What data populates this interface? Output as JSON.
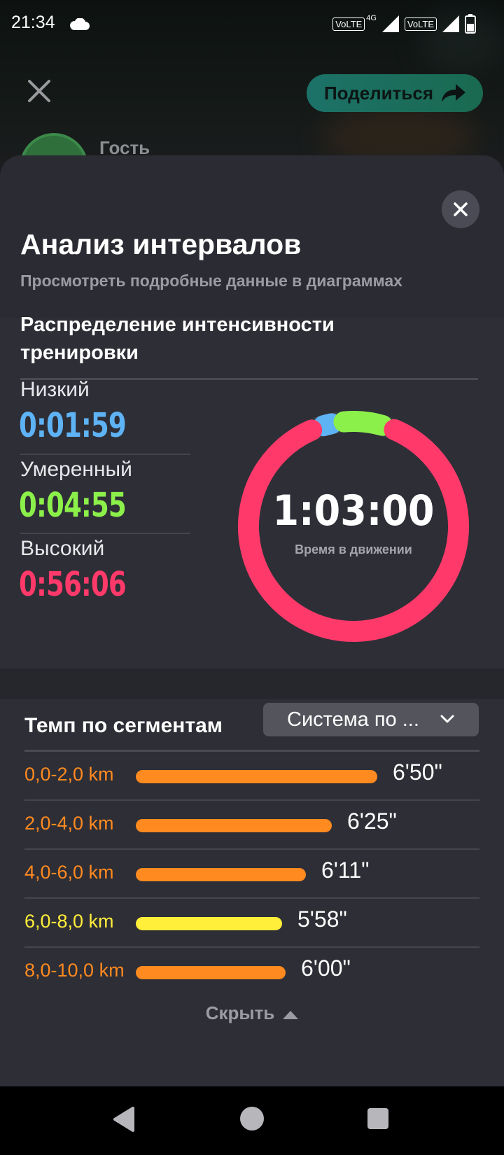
{
  "status_bar": {
    "time": "21:34",
    "weather_icon": "cloud-icon",
    "sim1": "VoLTE",
    "sim1_network": "4G",
    "sim2": "VoLTE",
    "battery_icon": "battery-icon"
  },
  "header": {
    "close_icon": "close-icon",
    "share_label": "Поделиться",
    "share_icon": "share-arrow-icon",
    "user_name": "Гость"
  },
  "sheet": {
    "title": "Анализ интервалов",
    "subtitle": "Просмотреть подробные данные в диаграммах",
    "intensity": {
      "title": "Распределение интенсивности тренировки",
      "zones": [
        {
          "label": "Низкий",
          "value": "0:01:59",
          "color": "#5eb3f5",
          "seconds": 119
        },
        {
          "label": "Умеренный",
          "value": "0:04:55",
          "color": "#8cf04a",
          "seconds": 295
        },
        {
          "label": "Высокий",
          "value": "0:56:06",
          "color": "#ff3a6a",
          "seconds": 3366
        }
      ],
      "total": "1:03:00",
      "total_label": "Время в движении"
    },
    "pace": {
      "title": "Темп по сегментам",
      "dropdown_value": "Система по ...",
      "segments": [
        {
          "range": "0,0-2,0 km",
          "pace": "6'50\"",
          "pace_seconds": 410,
          "color": "#ff8a1f"
        },
        {
          "range": "2,0-4,0 km",
          "pace": "6'25\"",
          "pace_seconds": 385,
          "color": "#ff8a1f"
        },
        {
          "range": "4,0-6,0 km",
          "pace": "6'11\"",
          "pace_seconds": 371,
          "color": "#ff8a1f"
        },
        {
          "range": "6,0-8,0 km",
          "pace": "5'58\"",
          "pace_seconds": 358,
          "color": "#ffee3a"
        },
        {
          "range": "8,0-10,0 km",
          "pace": "6'00\"",
          "pace_seconds": 360,
          "color": "#ff8a1f"
        }
      ]
    },
    "hide_label": "Скрыть"
  },
  "nav": {
    "back": "back-icon",
    "home": "home-icon",
    "recents": "recents-icon"
  }
}
